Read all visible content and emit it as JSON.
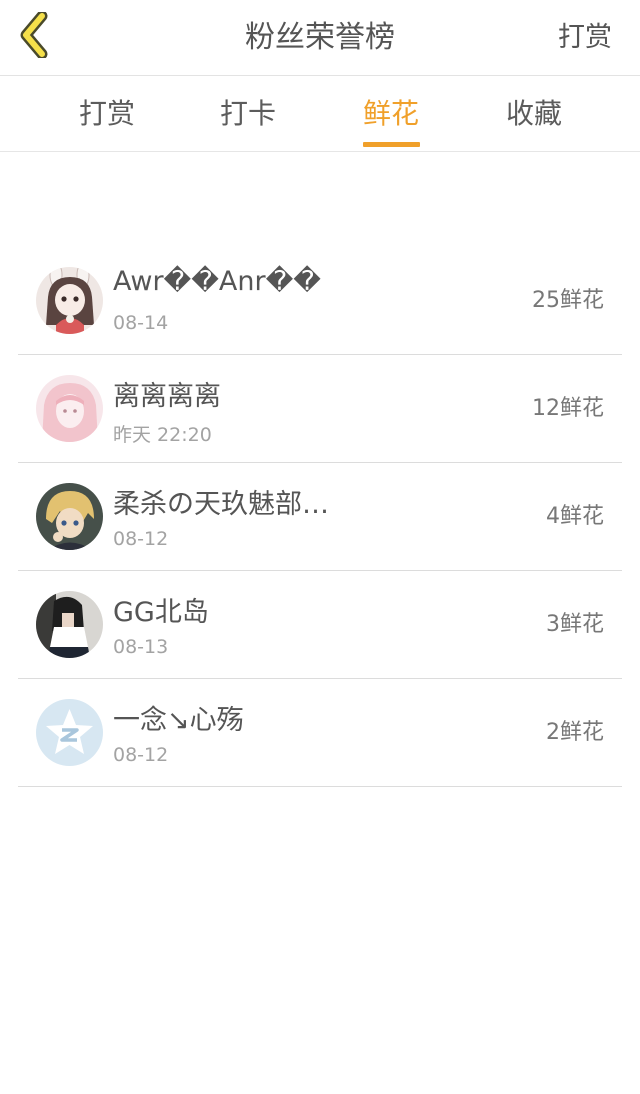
{
  "header": {
    "back_icon": "chevron-left-icon",
    "title": "粉丝荣誉榜",
    "action_label": "打赏"
  },
  "tabs": [
    {
      "label": "打赏",
      "active": false
    },
    {
      "label": "打卡",
      "active": false
    },
    {
      "label": "鲜花",
      "active": true
    },
    {
      "label": "收藏",
      "active": false
    }
  ],
  "colors": {
    "accent": "#f0a02a",
    "back_icon_fill": "#f5e04a",
    "back_icon_stroke": "#4a4a2a"
  },
  "fans": [
    {
      "name": "Awr��Anr��",
      "time": "08-14",
      "count": "25鲜花"
    },
    {
      "name": "离离离离",
      "time": "昨天 22:20",
      "count": "12鲜花"
    },
    {
      "name": "柔杀の天玖魅部…",
      "time": "08-12",
      "count": "4鲜花"
    },
    {
      "name": "GG北岛",
      "time": "08-13",
      "count": "3鲜花"
    },
    {
      "name": "一念↘心殇",
      "time": "08-12",
      "count": "2鲜花"
    }
  ]
}
